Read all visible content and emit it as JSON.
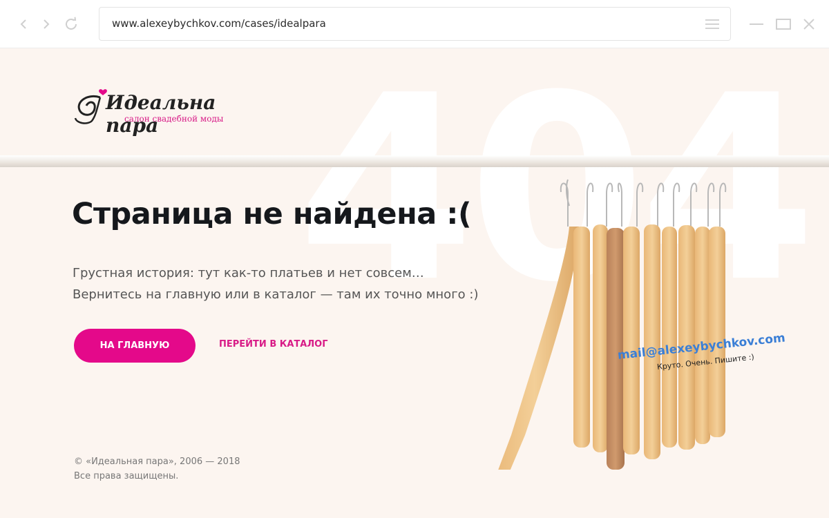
{
  "browser": {
    "url": "www.alexeybychkov.com/cases/idealpara",
    "icons": {
      "back": "back-arrow-icon",
      "forward": "forward-arrow-icon",
      "reload": "reload-icon",
      "menu": "hamburger-menu-icon",
      "minimize": "minimize-icon",
      "maximize": "maximize-icon",
      "close": "close-icon"
    }
  },
  "page": {
    "logo": {
      "title": "Идеальна пара",
      "subtitle": "салон свадебной моды"
    },
    "background_text": "404",
    "heading": "Страница не найдена :(",
    "description": {
      "line1": "Грустная история: тут как-то платьев и нет совсем…",
      "line2": "Вернитесь на главную или в каталог — там их точно много :)"
    },
    "buttons": {
      "home": "НА ГЛАВНУЮ",
      "catalog": "ПЕРЕЙТИ В КАТАЛОГ"
    },
    "footer": {
      "copyright": "© «Идеальная пара»,  2006 — 2018",
      "rights": "Все права защищены."
    },
    "contact": {
      "email": "mail@alexeybychkov.com",
      "note": "Круто. Очень. Пишите :)"
    }
  },
  "colors": {
    "accent": "#e4098a",
    "page_bg": "#fcf5f0",
    "link_blue": "#3b7fd6",
    "heading": "#15181c"
  }
}
